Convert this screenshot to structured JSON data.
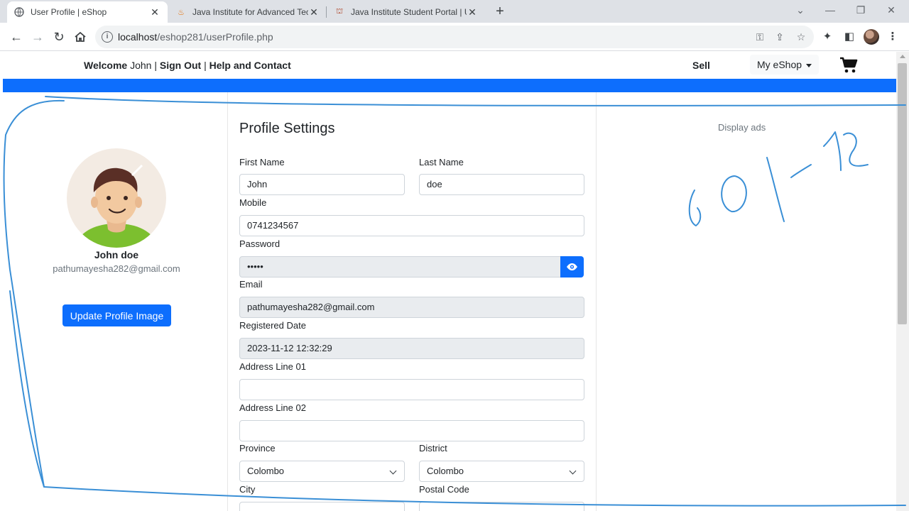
{
  "browser": {
    "tabs": [
      {
        "title": "User Profile | eShop"
      },
      {
        "title": "Java Institute for Advanced Tech"
      },
      {
        "title": "Java Institute Student Portal | Up"
      }
    ],
    "url_host": "localhost",
    "url_path": "/eshop281/userProfile.php"
  },
  "topnav": {
    "welcome_label": "Welcome",
    "welcome_name": "John",
    "sep1": " | ",
    "signout": "Sign Out",
    "sep2": " | ",
    "help": "Help and Contact",
    "sell": "Sell",
    "myeshop": "My eShop"
  },
  "profile": {
    "name": "John doe",
    "email": "pathumayesha282@gmail.com",
    "update_button": "Update Profile Image"
  },
  "form": {
    "title": "Profile Settings",
    "first_name_label": "First Name",
    "first_name": "John",
    "last_name_label": "Last Name",
    "last_name": "doe",
    "mobile_label": "Mobile",
    "mobile": "0741234567",
    "password_label": "Password",
    "password": "•••••",
    "email_label": "Email",
    "email": "pathumayesha282@gmail.com",
    "reg_date_label": "Registered Date",
    "reg_date": "2023-11-12 12:32:29",
    "address1_label": "Address Line 01",
    "address1": "",
    "address2_label": "Address Line 02",
    "address2": "",
    "province_label": "Province",
    "province": "Colombo",
    "district_label": "District",
    "district": "Colombo",
    "city_label": "City",
    "postal_label": "Postal Code"
  },
  "sidebar_right": {
    "ads": "Display ads"
  },
  "colors": {
    "primary": "#0d6efd",
    "annotation": "#3a8fd6"
  }
}
